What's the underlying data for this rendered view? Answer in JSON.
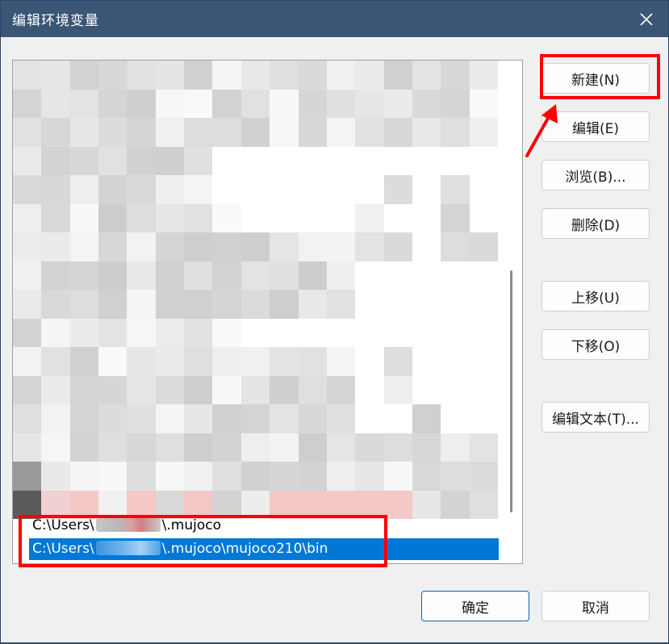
{
  "window": {
    "title": "编辑环境变量"
  },
  "list": {
    "items": [
      {
        "prefix": "C:\\Users\\",
        "suffix": "\\.mujoco",
        "selected": false
      },
      {
        "prefix": "C:\\Users\\",
        "suffix": "\\.mujoco\\mujoco210\\bin",
        "selected": true
      }
    ]
  },
  "buttons": {
    "new": "新建(N)",
    "edit": "编辑(E)",
    "browse": "浏览(B)...",
    "delete": "删除(D)",
    "move_up": "上移(U)",
    "move_down": "下移(O)",
    "edit_text": "编辑文本(T)...",
    "ok": "确定",
    "cancel": "取消"
  },
  "colors": {
    "title_bar": "#3b5576",
    "selection": "#0078d7",
    "annotation": "#ff0000",
    "primary_border": "#0067c0"
  }
}
